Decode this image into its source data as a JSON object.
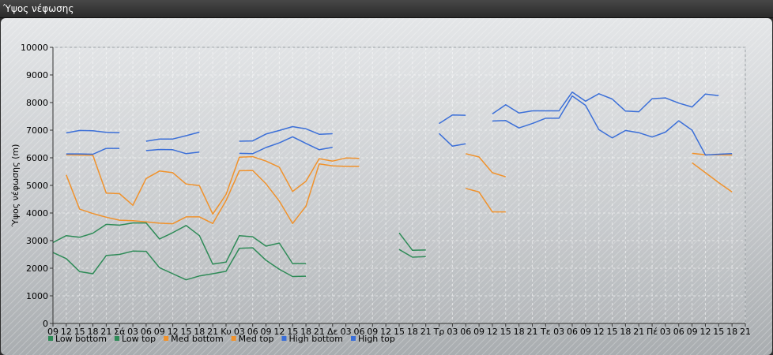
{
  "window": {
    "title": "Ύψος νέφωσης"
  },
  "chart_data": {
    "type": "line",
    "title": "",
    "xlabel": "",
    "ylabel": "Ύψος νέφωσης (m)",
    "ylim": [
      0,
      10000
    ],
    "yticks": [
      0,
      1000,
      2000,
      3000,
      4000,
      5000,
      6000,
      7000,
      8000,
      9000,
      10000
    ],
    "grid": true,
    "legend_position": "bottom-left",
    "categories": [
      "09",
      "12",
      "15",
      "18",
      "21",
      "Σά",
      "03",
      "06",
      "09",
      "12",
      "15",
      "18",
      "21",
      "Κυ",
      "03",
      "06",
      "09",
      "12",
      "15",
      "18",
      "21",
      "Δε",
      "03",
      "06",
      "09",
      "12",
      "15",
      "18",
      "21",
      "Τρ",
      "03",
      "06",
      "09",
      "12",
      "15",
      "18",
      "21",
      "Τε",
      "03",
      "06",
      "09",
      "12",
      "15",
      "18",
      "21",
      "Πέ",
      "03",
      "06",
      "09",
      "12",
      "15",
      "18",
      "21"
    ],
    "series": [
      {
        "name": "Low bottom",
        "color": "#2e8b57",
        "values": [
          2570,
          2350,
          1880,
          1800,
          2460,
          2500,
          2620,
          2610,
          2020,
          1800,
          1580,
          1720,
          1800,
          1890,
          2720,
          2740,
          2290,
          1960,
          1700,
          1710,
          null,
          null,
          null,
          null,
          null,
          null,
          2680,
          2400,
          2420,
          null,
          null,
          null,
          null,
          null,
          null,
          null,
          null,
          null,
          null,
          null,
          null,
          null,
          null,
          null,
          null,
          null,
          null,
          null,
          null,
          null,
          null,
          null,
          null
        ]
      },
      {
        "name": "Low top",
        "color": "#2e8b57",
        "values": [
          2930,
          3180,
          3120,
          3270,
          3590,
          3560,
          3640,
          3640,
          3060,
          3290,
          3550,
          3180,
          2150,
          2220,
          3180,
          3140,
          2800,
          2910,
          2170,
          2170,
          null,
          null,
          null,
          null,
          null,
          null,
          3280,
          2650,
          2660,
          null,
          null,
          null,
          null,
          null,
          null,
          null,
          null,
          null,
          null,
          null,
          null,
          null,
          null,
          null,
          null,
          null,
          null,
          null,
          null,
          null,
          null,
          null,
          null
        ]
      },
      {
        "name": "Med bottom",
        "color": "#f0922c",
        "values": [
          null,
          5380,
          4140,
          3980,
          3850,
          3740,
          3720,
          3680,
          3630,
          3610,
          3860,
          3860,
          3620,
          4450,
          5530,
          5540,
          5060,
          4430,
          3620,
          4250,
          5780,
          5710,
          5690,
          5690,
          null,
          null,
          null,
          null,
          null,
          null,
          null,
          4890,
          4760,
          4040,
          4040,
          null,
          null,
          null,
          null,
          null,
          null,
          null,
          null,
          null,
          null,
          null,
          null,
          null,
          5820,
          5460,
          5100,
          4760,
          null
        ]
      },
      {
        "name": "Med top",
        "color": "#f0922c",
        "values": [
          null,
          6110,
          6100,
          6090,
          4720,
          4700,
          4280,
          5250,
          5520,
          5460,
          5050,
          4990,
          3960,
          4670,
          6020,
          6040,
          5880,
          5660,
          4780,
          5150,
          5970,
          5880,
          5990,
          5980,
          null,
          null,
          null,
          null,
          null,
          null,
          null,
          6150,
          6030,
          5460,
          5310,
          null,
          null,
          null,
          null,
          null,
          null,
          null,
          null,
          null,
          null,
          null,
          null,
          null,
          6160,
          6110,
          6110,
          6100,
          null
        ]
      },
      {
        "name": "High bottom",
        "color": "#3b6fd8",
        "values": [
          null,
          6140,
          6140,
          6130,
          6340,
          6340,
          null,
          6260,
          6300,
          6290,
          6150,
          6210,
          null,
          null,
          6160,
          6150,
          6370,
          6540,
          6760,
          6520,
          6290,
          6380,
          null,
          null,
          null,
          null,
          null,
          null,
          null,
          6880,
          6420,
          6510,
          null,
          7330,
          7350,
          7080,
          7240,
          7430,
          7430,
          8240,
          7900,
          7020,
          6720,
          6990,
          6910,
          6750,
          6930,
          7340,
          7000,
          6100,
          6130,
          6150,
          null
        ]
      },
      {
        "name": "High top",
        "color": "#3b6fd8",
        "values": [
          null,
          6900,
          6990,
          6980,
          6920,
          6910,
          null,
          6600,
          6680,
          6680,
          6800,
          6930,
          null,
          null,
          6600,
          6610,
          6860,
          6990,
          7130,
          7050,
          6850,
          6870,
          null,
          null,
          null,
          null,
          null,
          null,
          null,
          7240,
          7550,
          7540,
          null,
          7590,
          7920,
          7620,
          7700,
          7700,
          7700,
          8380,
          8050,
          8320,
          8130,
          7690,
          7670,
          8140,
          8170,
          7980,
          7840,
          8310,
          8250,
          null,
          null
        ]
      }
    ]
  }
}
